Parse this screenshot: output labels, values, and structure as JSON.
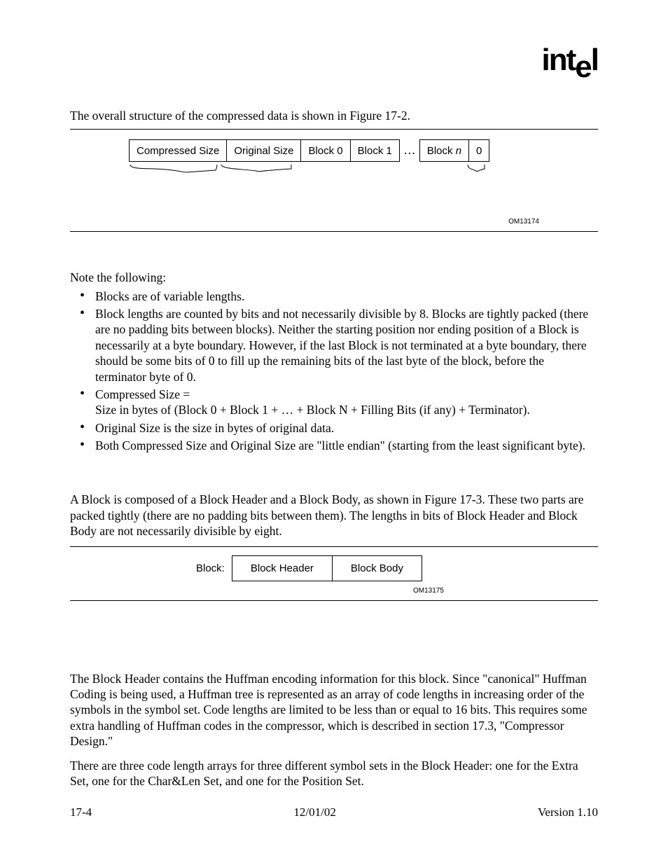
{
  "logo_alt": "intel",
  "intro": "The overall structure of the compressed data is shown in Figure 17-2.",
  "fig1": {
    "cells": [
      "Compressed Size",
      "Original Size",
      "Block 0",
      "Block 1",
      "…",
      "Block ",
      "0"
    ],
    "block_n_italic": "n",
    "om": "OM13174"
  },
  "note_lead": "Note the following:",
  "bullets": {
    "b1": "Blocks are of variable lengths.",
    "b2": "Block lengths are counted by bits and not necessarily divisible by 8.  Blocks are tightly packed (there are no padding bits between blocks).  Neither the starting position nor ending position of a Block is necessarily at a byte boundary.  However, if the last Block is not terminated at a byte boundary, there should be some bits of 0 to fill up the remaining bits of the last byte of the block, before the terminator byte of 0.",
    "b3a": "Compressed Size =",
    "b3b": "Size in bytes of (Block 0 + Block 1 + … + Block N + Filling Bits (if any) + Terminator).",
    "b4": "Original Size is the size in bytes of original data.",
    "b5": "Both Compressed Size and Original Size are \"little endian\" (starting from the least significant byte)."
  },
  "para2": "A Block is composed of a Block Header and a Block Body, as shown in Figure 17-3.  These two parts are packed tightly (there are no padding bits between them).  The lengths in bits of Block Header and Block Body are not necessarily divisible by eight.",
  "fig2": {
    "label": "Block:",
    "c1": "Block Header",
    "c2": "Block Body",
    "om": "OM13175"
  },
  "para3": "The Block Header contains the Huffman encoding information for this block.  Since \"canonical\" Huffman Coding is being used, a Huffman tree is represented as an array of code lengths in increasing order of the symbols in the symbol set.  Code lengths are limited to be less than or equal to 16 bits.  This requires some extra handling of Huffman codes in the compressor, which is described in section 17.3, \"Compressor Design.\"",
  "para4": "There are three code length arrays for three different symbol sets in the Block Header: one for the Extra Set, one for the Char&Len Set, and one for the Position Set.",
  "footer": {
    "left": "17-4",
    "center": "12/01/02",
    "right": "Version 1.10"
  }
}
